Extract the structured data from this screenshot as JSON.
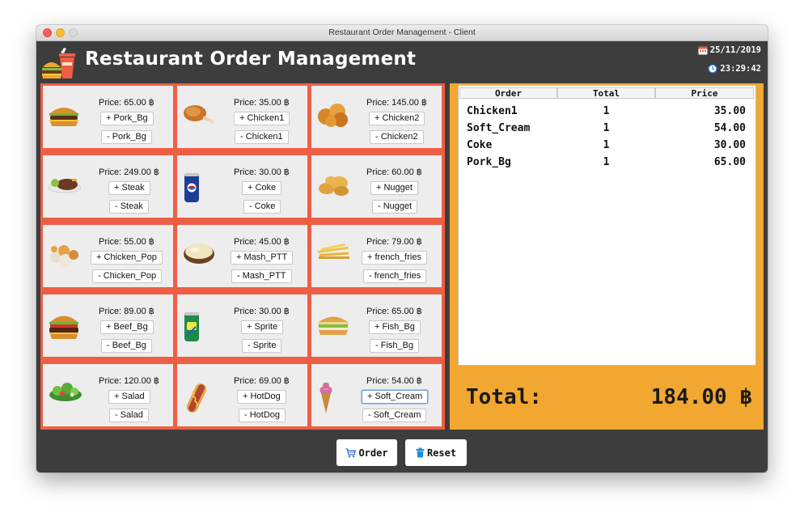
{
  "window": {
    "title": "Restaurant Order Management - Client"
  },
  "header": {
    "app_title": "Restaurant Order Management",
    "date": "25/11/2019",
    "time": "23:29:42",
    "logo_icon": "burger-drink-logo-icon",
    "calendar_icon": "calendar-icon",
    "clock_icon": "clock-icon"
  },
  "menu": [
    {
      "price": "Price: 65.00 ฿",
      "add": "+ Pork_Bg",
      "remove": "- Pork_Bg",
      "icon": "burger-icon"
    },
    {
      "price": "Price: 35.00 ฿",
      "add": "+ Chicken1",
      "remove": "- Chicken1",
      "icon": "chicken-leg-icon"
    },
    {
      "price": "Price: 145.00 ฿",
      "add": "+ Chicken2",
      "remove": "- Chicken2",
      "icon": "fried-chicken-icon"
    },
    {
      "price": "Price: 249.00 ฿",
      "add": "+ Steak",
      "remove": "- Steak",
      "icon": "steak-icon"
    },
    {
      "price": "Price: 30.00 ฿",
      "add": "+ Coke",
      "remove": "- Coke",
      "icon": "coke-can-icon"
    },
    {
      "price": "Price: 60.00 ฿",
      "add": "+ Nugget",
      "remove": "- Nugget",
      "icon": "nugget-icon"
    },
    {
      "price": "Price: 55.00 ฿",
      "add": "+ Chicken_Pop",
      "remove": "- Chicken_Pop",
      "icon": "popcorn-chicken-icon"
    },
    {
      "price": "Price: 45.00 ฿",
      "add": "+ Mash_PTT",
      "remove": "- Mash_PTT",
      "icon": "mashed-potato-icon"
    },
    {
      "price": "Price: 79.00 ฿",
      "add": "+ french_fries",
      "remove": "- french_fries",
      "icon": "french-fries-icon"
    },
    {
      "price": "Price: 89.00 ฿",
      "add": "+ Beef_Bg",
      "remove": "- Beef_Bg",
      "icon": "beef-burger-icon"
    },
    {
      "price": "Price: 30.00 ฿",
      "add": "+ Sprite",
      "remove": "- Sprite",
      "icon": "sprite-can-icon"
    },
    {
      "price": "Price: 65.00 ฿",
      "add": "+ Fish_Bg",
      "remove": "- Fish_Bg",
      "icon": "fish-burger-icon"
    },
    {
      "price": "Price: 120.00 ฿",
      "add": "+ Salad",
      "remove": "- Salad",
      "icon": "salad-icon"
    },
    {
      "price": "Price: 69.00 ฿",
      "add": "+ HotDog",
      "remove": "- HotDog",
      "icon": "hotdog-icon"
    },
    {
      "price": "Price: 54.00 ฿",
      "add": "+ Soft_Cream",
      "remove": "- Soft_Cream",
      "icon": "ice-cream-icon"
    }
  ],
  "order_table": {
    "columns": [
      "Order",
      "Total",
      "Price"
    ],
    "rows": [
      {
        "name": "Chicken1",
        "total": "1",
        "price": "35.00"
      },
      {
        "name": "Soft_Cream",
        "total": "1",
        "price": "54.00"
      },
      {
        "name": "Coke",
        "total": "1",
        "price": "30.00"
      },
      {
        "name": "Pork_Bg",
        "total": "1",
        "price": "65.00"
      }
    ]
  },
  "summary": {
    "total_label": "Total:",
    "total_value": "184.00 ฿"
  },
  "actions": {
    "order": "Order",
    "reset": "Reset",
    "order_icon": "cart-icon",
    "reset_icon": "trash-icon"
  },
  "colors": {
    "menu_bg": "#ee5e45",
    "order_bg": "#f2a731",
    "window_bg": "#3d3d3d"
  }
}
